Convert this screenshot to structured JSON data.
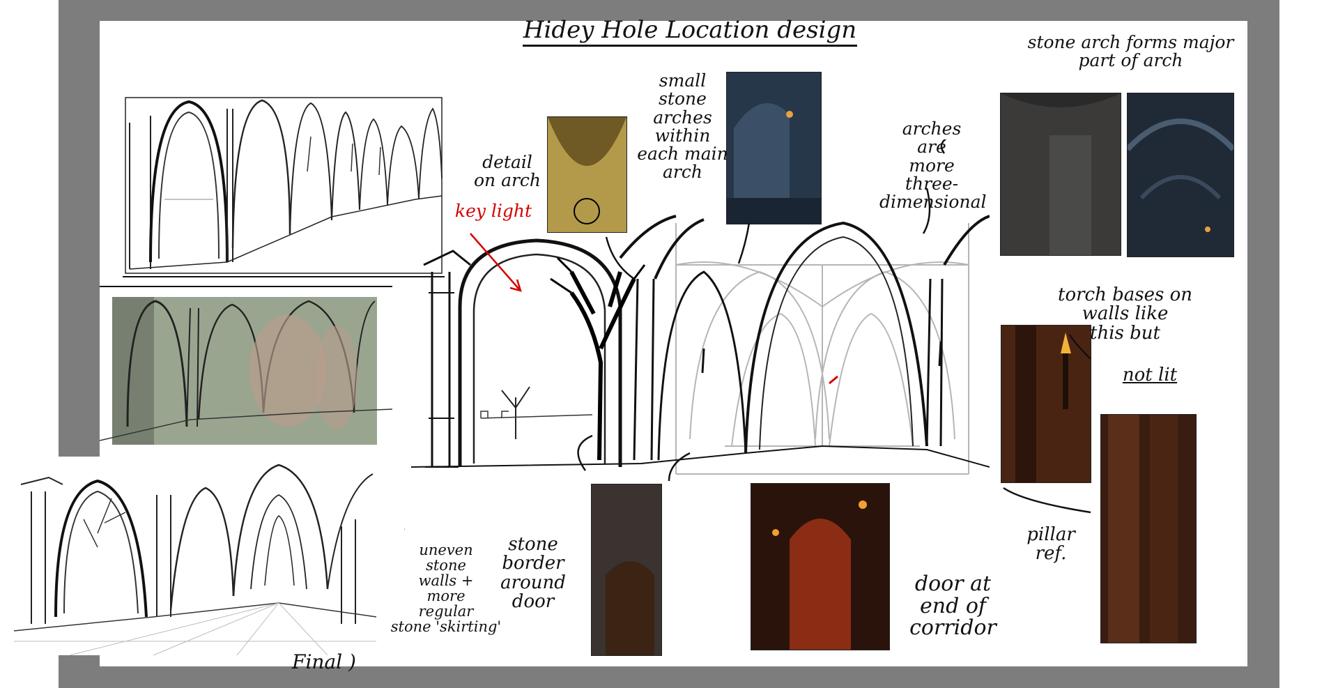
{
  "title": "Hidey Hole Location design",
  "notes": {
    "small_stone_arches": "small\nstone\narches\nwithin\neach main\narch",
    "stone_arch_major": "stone arch forms major\npart of arch",
    "detail_on_arch": "detail\non arch",
    "key_light": "key light",
    "arches_3d": "arches\nare\nmore\nthree-\ndimensional",
    "torch_bases": "torch bases on\nwalls like\nthis but",
    "not_lit": "not lit",
    "pillar_ref": "pillar\nref.",
    "uneven_walls": "uneven\nstone\nwalls +\nmore\nregular\nstone 'skirting'",
    "stone_border": "stone\nborder\naround\ndoor",
    "door_at_end": "door at\nend of\ncorridor",
    "final": "Final )"
  },
  "colors": {
    "frame": "#7d7d7d",
    "ink": "#111111",
    "key_light": "#d40000",
    "guide_grey": "#b5b5b5",
    "sketch_green": "#9aa590"
  }
}
